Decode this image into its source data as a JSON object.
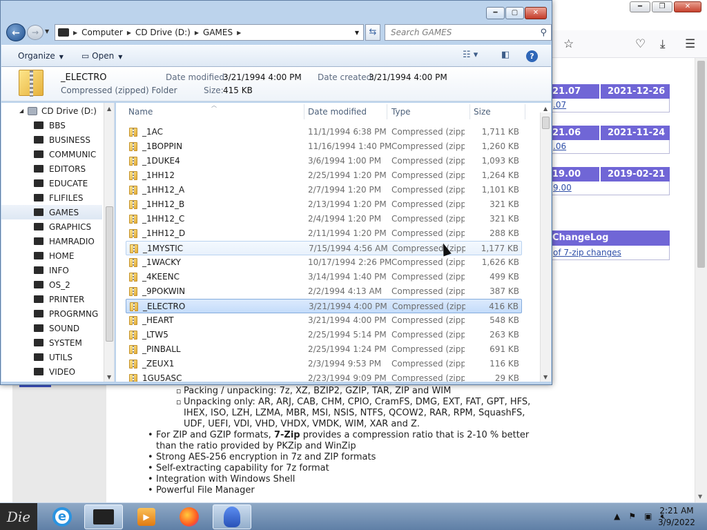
{
  "browser": {
    "releases": [
      {
        "version": "21.07",
        "date": "2021-12-26",
        "link": ".07"
      },
      {
        "version": "21.06",
        "date": "2021-11-24",
        "link": ".06"
      },
      {
        "version": "19.00",
        "date": "2019-02-21",
        "link": "9.00"
      }
    ],
    "changelog": {
      "title": "ChangeLog",
      "link": "of 7-zip changes"
    },
    "features": {
      "sub": [
        "Packing / unpacking: 7z, XZ, BZIP2, GZIP, TAR, ZIP and WIM",
        "Unpacking only: AR, ARJ, CAB, CHM, CPIO, CramFS, DMG, EXT, FAT, GPT, HFS, IHEX, ISO, LZH, LZMA, MBR, MSI, NSIS, NTFS, QCOW2, RAR, RPM, SquashFS, UDF, UEFI, VDI, VHD, VHDX, VMDK, WIM, XAR and Z."
      ],
      "main": [
        {
          "before": "For ZIP and GZIP formats, ",
          "bold": "7-Zip",
          "after": " provides a compression ratio that is 2-10 % better than the ratio provided by PKZip and WinZip"
        },
        {
          "before": "Strong AES-256 encryption in 7z and ZIP formats",
          "bold": "",
          "after": ""
        },
        {
          "before": "Self-extracting capability for 7z format",
          "bold": "",
          "after": ""
        },
        {
          "before": "Integration with Windows Shell",
          "bold": "",
          "after": ""
        },
        {
          "before": "Powerful File Manager",
          "bold": "",
          "after": ""
        }
      ]
    }
  },
  "explorer": {
    "address": [
      "Computer",
      "CD Drive (D:)",
      "GAMES"
    ],
    "search_placeholder": "Search GAMES",
    "commands": {
      "organize": "Organize",
      "open": "Open"
    },
    "details": {
      "name": "_ELECTRO",
      "type": "Compressed (zipped) Folder",
      "modified_label": "Date modified:",
      "modified": "3/21/1994 4:00 PM",
      "created_label": "Date created:",
      "created": "3/21/1994 4:00 PM",
      "size_label": "Size:",
      "size": "415 KB"
    },
    "tree": {
      "drive": "CD Drive (D:)",
      "folders": [
        "BBS",
        "BUSINESS",
        "COMMUNIC",
        "EDITORS",
        "EDUCATE",
        "FLIFILES",
        "GAMES",
        "GRAPHICS",
        "HAMRADIO",
        "HOME",
        "INFO",
        "OS_2",
        "PRINTER",
        "PROGRMNG",
        "SOUND",
        "SYSTEM",
        "UTILS",
        "VIDEO"
      ],
      "selected": "GAMES"
    },
    "columns": {
      "name": "Name",
      "modified": "Date modified",
      "type": "Type",
      "size": "Size"
    },
    "files": [
      {
        "name": "_1AC",
        "date": "11/1/1994 6:38 PM",
        "type": "Compressed (zipp...",
        "size": "1,711 KB"
      },
      {
        "name": "_1BOPPIN",
        "date": "11/16/1994 1:40 PM",
        "type": "Compressed (zipp...",
        "size": "1,260 KB"
      },
      {
        "name": "_1DUKE4",
        "date": "3/6/1994 1:00 PM",
        "type": "Compressed (zipp...",
        "size": "1,093 KB"
      },
      {
        "name": "_1HH12",
        "date": "2/25/1994 1:20 PM",
        "type": "Compressed (zipp...",
        "size": "1,264 KB"
      },
      {
        "name": "_1HH12_A",
        "date": "2/7/1994 1:20 PM",
        "type": "Compressed (zipp...",
        "size": "1,101 KB"
      },
      {
        "name": "_1HH12_B",
        "date": "2/13/1994 1:20 PM",
        "type": "Compressed (zipp...",
        "size": "321 KB"
      },
      {
        "name": "_1HH12_C",
        "date": "2/4/1994 1:20 PM",
        "type": "Compressed (zipp...",
        "size": "321 KB"
      },
      {
        "name": "_1HH12_D",
        "date": "2/11/1994 1:20 PM",
        "type": "Compressed (zipp...",
        "size": "288 KB"
      },
      {
        "name": "_1MYSTIC",
        "date": "7/15/1994 4:56 AM",
        "type": "Compressed (zipp...",
        "size": "1,177 KB"
      },
      {
        "name": "_1WACKY",
        "date": "10/17/1994 2:26 PM",
        "type": "Compressed (zipp...",
        "size": "1,626 KB"
      },
      {
        "name": "_4KEENC",
        "date": "3/14/1994 1:40 PM",
        "type": "Compressed (zipp...",
        "size": "499 KB"
      },
      {
        "name": "_9POKWIN",
        "date": "2/2/1994 4:13 AM",
        "type": "Compressed (zipp...",
        "size": "387 KB"
      },
      {
        "name": "_ELECTRO",
        "date": "3/21/1994 4:00 PM",
        "type": "Compressed (zipp...",
        "size": "416 KB"
      },
      {
        "name": "_HEART",
        "date": "3/21/1994 4:00 PM",
        "type": "Compressed (zipp...",
        "size": "548 KB"
      },
      {
        "name": "_LTW5",
        "date": "2/25/1994 5:14 PM",
        "type": "Compressed (zipp...",
        "size": "263 KB"
      },
      {
        "name": "_PINBALL",
        "date": "2/25/1994 1:24 PM",
        "type": "Compressed (zipp...",
        "size": "691 KB"
      },
      {
        "name": "_ZEUX1",
        "date": "2/3/1994 9:53 PM",
        "type": "Compressed (zipp...",
        "size": "116 KB"
      },
      {
        "name": "1GU5ASC",
        "date": "2/23/1994 9:09 PM",
        "type": "Compressed (zipp...",
        "size": "29 KB"
      }
    ],
    "selected_file": "_ELECTRO",
    "hovered_file": "_1MYSTIC"
  },
  "taskbar": {
    "start_label": "Die",
    "ie_glyph": "e",
    "time": "2:21 AM",
    "date": "3/9/2022"
  }
}
